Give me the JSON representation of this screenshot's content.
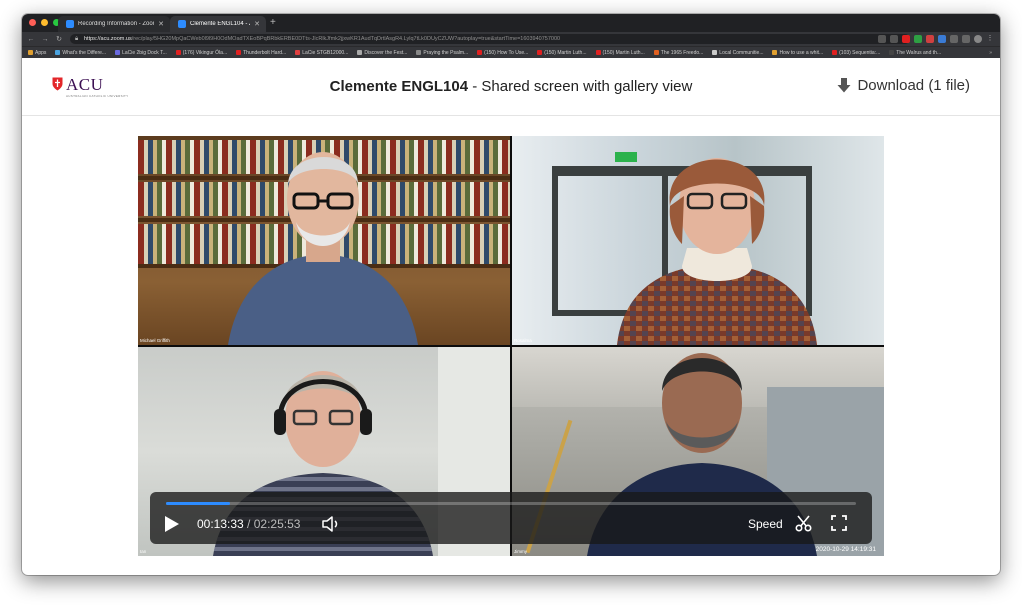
{
  "browser": {
    "tabs": [
      {
        "label": "Recording Information - Zoom",
        "active": false
      },
      {
        "label": "Clemente ENGL104 - Zoom",
        "active": true
      }
    ],
    "url_host": "https://acu.zoom.us",
    "url_path": "/rec/play/5HG20MpQaCWeb0l9l9H0OdMOadTXEoBPqBRbkERBE0DTts-JlcRlkJfmk2jjxwKR1AudTqDrtlAsgR4.Lylq7tLk0DUyCZUW?autoplay=true&startTime=1603940757000",
    "bookmarks": [
      {
        "label": "Apps",
        "color": "#e0a030"
      },
      {
        "label": "What's the Differe...",
        "color": "#4aa3df"
      },
      {
        "label": "LaCie 2big Dock T...",
        "color": "#6a6ae0"
      },
      {
        "label": "(176) Vikingur Óla...",
        "color": "#e02020"
      },
      {
        "label": "Thunderbolt Hard...",
        "color": "#e02020"
      },
      {
        "label": "LaCie STGB12000...",
        "color": "#e04040"
      },
      {
        "label": "Discover the Fest...",
        "color": "#aaaaaa"
      },
      {
        "label": "Praying the Psalm...",
        "color": "#888888"
      },
      {
        "label": "(150) How To Use...",
        "color": "#e02020"
      },
      {
        "label": "(150) Martin Luth...",
        "color": "#e02020"
      },
      {
        "label": "(150) Martin Luth...",
        "color": "#e02020"
      },
      {
        "label": "The 1965 Freedo...",
        "color": "#e06020"
      },
      {
        "label": "Local Communitie...",
        "color": "#cccccc"
      },
      {
        "label": "How to use a whit...",
        "color": "#e0a030"
      },
      {
        "label": "(103) Sequentia:...",
        "color": "#e02020"
      },
      {
        "label": "The Walrus and th...",
        "color": "#444444"
      }
    ],
    "bookmarks_more": "»"
  },
  "header": {
    "logo_text": "ACU",
    "logo_sub": "AUSTRALIAN CATHOLIC UNIVERSITY",
    "title_bold": "Clemente ENGL104",
    "title_rest": " - Shared screen with gallery view",
    "download_label": "Download (1 file)"
  },
  "video": {
    "participants": [
      "Michael Griffith",
      "Rosalma",
      "Ian",
      "Jimmy"
    ],
    "current_time": "00:13:33",
    "separator": " / ",
    "duration": "02:25:53",
    "progress_fraction": 0.093,
    "speed_label": "Speed",
    "timestamp": "2020-10-29 14:19:31"
  },
  "colors": {
    "acu_purple": "#3c1053",
    "acu_red": "#e3262a",
    "zoom_blue": "#2d8cff"
  }
}
